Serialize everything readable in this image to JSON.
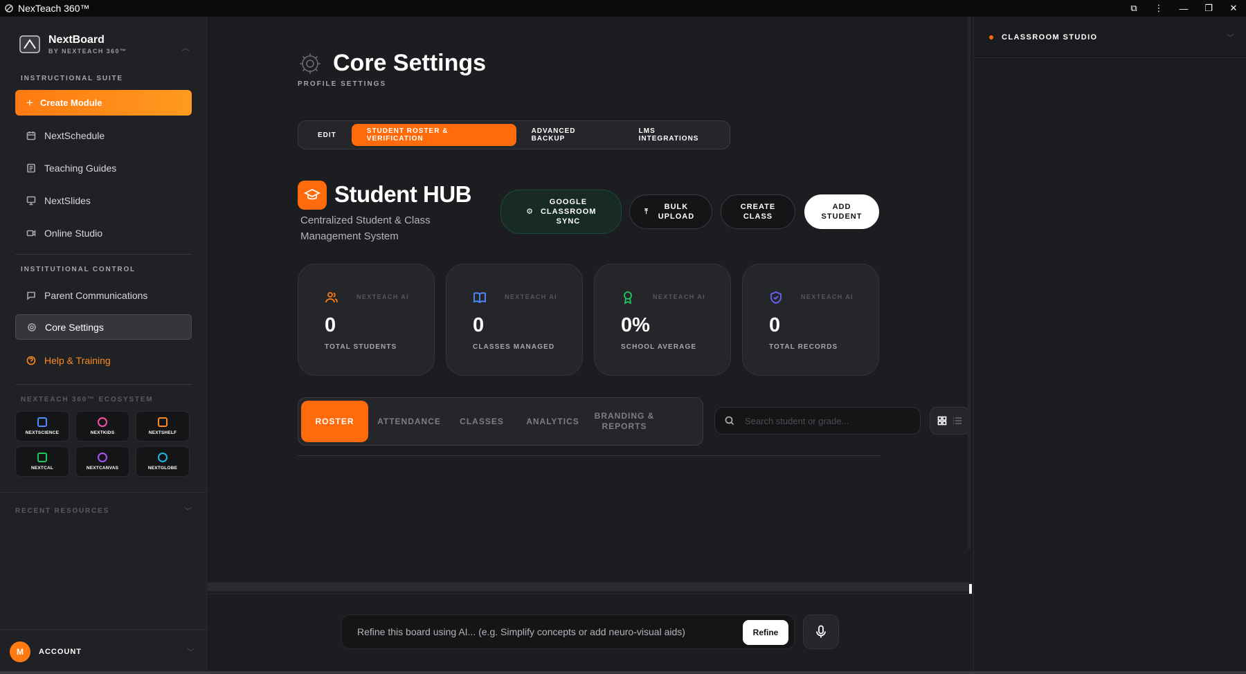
{
  "window": {
    "title": "NexTeach 360™"
  },
  "sidebar": {
    "brand_name": "NextBoard",
    "brand_sub": "BY NEXTEACH 360™",
    "section_instructional": "INSTRUCTIONAL SUITE",
    "create_label": "Create Module",
    "items": [
      {
        "label": "NextSchedule",
        "icon": "calendar-icon"
      },
      {
        "label": "Teaching Guides",
        "icon": "book-icon"
      },
      {
        "label": "NextSlides",
        "icon": "presentation-icon"
      },
      {
        "label": "Online Studio",
        "icon": "video-icon"
      }
    ],
    "section_institutional": "INSTITUTIONAL CONTROL",
    "parent_comm": "Parent Communications",
    "core_settings": "Core Settings",
    "help": "Help & Training",
    "ecosystem_label": "NEXTEACH 360™ ECOSYSTEM",
    "ecosystem": [
      {
        "label": "NEXTSCIENCE",
        "color": "#4f8cff"
      },
      {
        "label": "NEXTKIDS",
        "color": "#ff4fa8"
      },
      {
        "label": "NEXTSHELF",
        "color": "#ff8a1f"
      },
      {
        "label": "NEXTCAL",
        "color": "#22c55e"
      },
      {
        "label": "NEXTCANVAS",
        "color": "#a855f7"
      },
      {
        "label": "NEXTGLOBE",
        "color": "#22b8e6"
      }
    ],
    "recent": "RECENT RESOURCES",
    "account_initial": "M",
    "account": "ACCOUNT"
  },
  "main": {
    "page_title": "Core Settings",
    "page_sub": "PROFILE SETTINGS",
    "tabs": [
      "EDIT",
      "STUDENT ROSTER & VERIFICATION",
      "ADVANCED BACKUP",
      "LMS INTEGRATIONS"
    ],
    "hub_title": "Student HUB",
    "hub_sub": "Centralized Student & Class Management System",
    "actions": {
      "google_sync": "GOOGLE CLASSROOM SYNC",
      "bulk_upload": "BULK UPLOAD",
      "create_class": "CREATE CLASS",
      "add_student": "ADD STUDENT"
    },
    "stats": [
      {
        "ai": "NEXTEACH AI",
        "value": "0",
        "label": "TOTAL STUDENTS"
      },
      {
        "ai": "NEXTEACH AI",
        "value": "0",
        "label": "CLASSES MANAGED"
      },
      {
        "ai": "NEXTEACH AI",
        "value": "0%",
        "label": "SCHOOL AVERAGE"
      },
      {
        "ai": "NEXTEACH AI",
        "value": "0",
        "label": "TOTAL RECORDS"
      }
    ],
    "subtabs": [
      "ROSTER",
      "ATTENDANCE",
      "CLASSES",
      "ANALYTICS",
      "BRANDING & REPORTS"
    ],
    "search_placeholder": "Search student or grade...",
    "refine_placeholder": "Refine this board using AI... (e.g. Simplify concepts or add neuro-visual aids)",
    "refine_btn": "Refine"
  },
  "right_panel": {
    "title": "CLASSROOM STUDIO"
  },
  "colors": {
    "accent": "#ff6a0a",
    "bg": "#1c1d20"
  }
}
